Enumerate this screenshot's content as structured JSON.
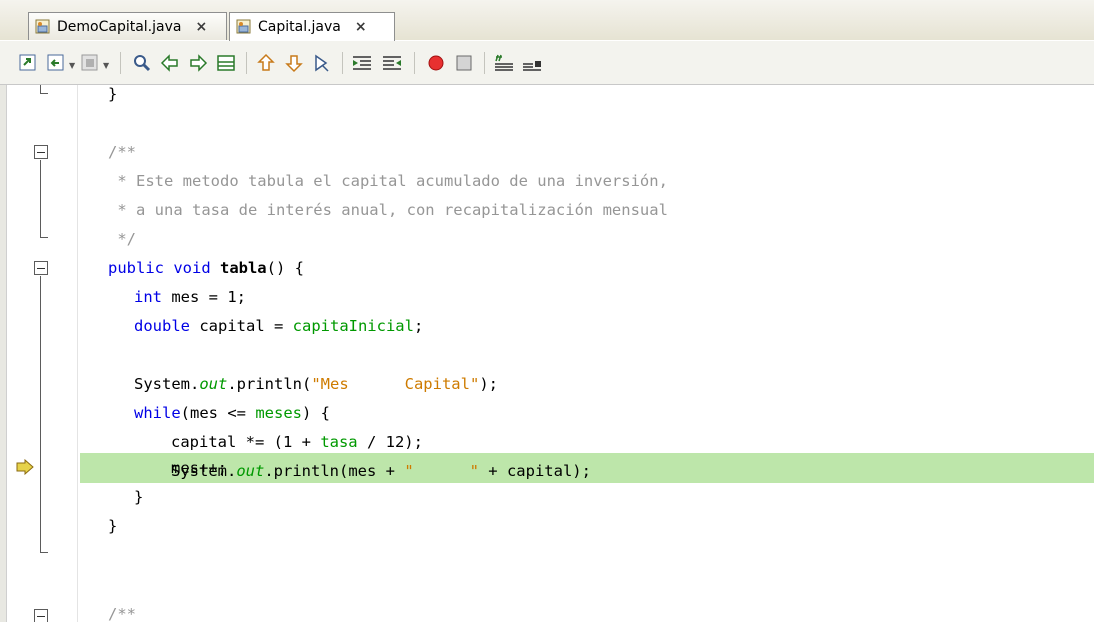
{
  "tabs": [
    {
      "label": "DemoCapital.java",
      "close": "×"
    },
    {
      "label": "Capital.java",
      "close": "×"
    }
  ],
  "toolbar": {
    "icons": [
      "last-edit-icon",
      "back-icon",
      "forward-icon",
      "find-selection-icon",
      "find-previous-icon",
      "find-next-icon",
      "toggle-highlight-icon",
      "previous-bookmark-icon",
      "next-bookmark-icon",
      "toggle-bookmark-icon",
      "shift-left-icon",
      "shift-right-icon",
      "start-macro-icon",
      "stop-macro-icon",
      "comment-icon",
      "uncomment-icon"
    ]
  },
  "code": {
    "l0": "}",
    "l2": "/**",
    "l3": " * Este metodo tabula el capital acumulado de una inversión,",
    "l4": " * a una tasa de interés anual, con recapitalización mensual",
    "l5": " */",
    "l6_kw": "public void ",
    "l6_name": "tabla",
    "l6_rest": "() {",
    "l7_kw": "int",
    "l7_rest": " mes = 1;",
    "l8_kw": "double",
    "l8_mid": " capital = ",
    "l8_fld": "capitaInicial",
    "l8_end": ";",
    "l10_a": "System.",
    "l10_out": "out",
    "l10_b": ".println(",
    "l10_str": "\"Mes      Capital\"",
    "l10_c": ");",
    "l11_kw": "while",
    "l11_a": "(mes <= ",
    "l11_fld": "meses",
    "l11_b": ") {",
    "l12_a": "capital *= (1 + ",
    "l12_fld": "tasa",
    "l12_b": " / 12);",
    "l13_a": "System.",
    "l13_out": "out",
    "l13_b": ".println(mes + ",
    "l13_str": "\"      \"",
    "l13_c": " + capital);",
    "l14": "mes++;",
    "l15": "}",
    "l16": "}",
    "l18": "/**"
  },
  "colors": {
    "keyword": "#0000e6",
    "field": "#009900",
    "string": "#ce7b00",
    "comment": "#969696",
    "current_line": "#bde6aa"
  }
}
